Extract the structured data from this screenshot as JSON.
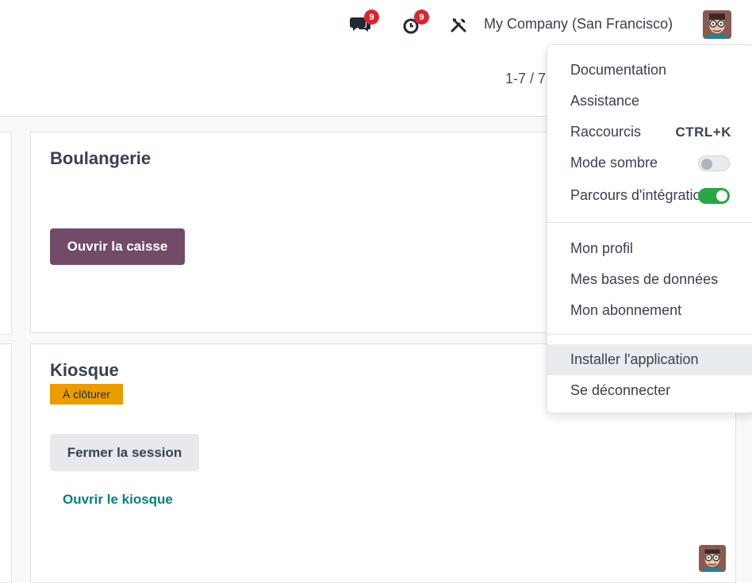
{
  "topbar": {
    "chat_badge": "9",
    "activity_badge": "9",
    "company": "My Company (San Francisco)"
  },
  "pager": {
    "text": "1-7 / 7"
  },
  "cards": [
    {
      "title": "Boulangerie",
      "button": "Ouvrir la caisse"
    },
    {
      "title": "Kiosque",
      "tag": "À clôturer",
      "button": "Fermer la session",
      "link": "Ouvrir le kiosque"
    }
  ],
  "user_menu": {
    "documentation": "Documentation",
    "support": "Assistance",
    "shortcuts": "Raccourcis",
    "shortcuts_key": "CTRL+K",
    "dark_mode": "Mode sombre",
    "dark_mode_on": false,
    "onboarding": "Parcours d'intégration",
    "onboarding_on": true,
    "profile": "Mon profil",
    "databases": "Mes bases de données",
    "subscription": "Mon abonnement",
    "install_app": "Installer l'application",
    "logout": "Se déconnecter"
  },
  "colors": {
    "primary": "#714b67",
    "badge": "#d9252f",
    "tag": "#e99d00",
    "link": "#017e84",
    "toggle_on": "#28a745"
  }
}
